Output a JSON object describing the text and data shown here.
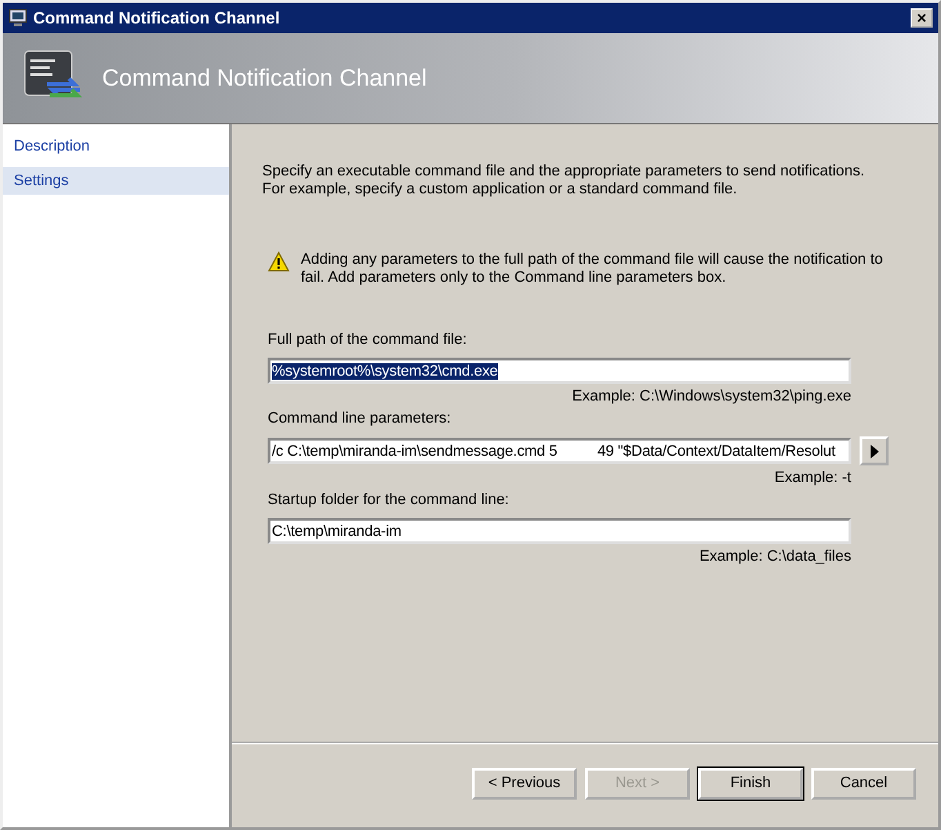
{
  "window": {
    "title": "Command Notification Channel",
    "close": "×"
  },
  "header": {
    "title": "Command Notification Channel"
  },
  "sidebar": {
    "items": [
      {
        "label": "Description",
        "selected": false
      },
      {
        "label": "Settings",
        "selected": true
      }
    ]
  },
  "intro": "Specify an executable command file and the appropriate parameters to send notifications. For example, specify a custom application or a standard command file.",
  "warning": "Adding any parameters to the full path of the command file will cause the notification to fail. Add parameters only to the Command line parameters box.",
  "fields": [
    {
      "label": "Full path of the command file:",
      "value": "%systemroot%\\system32\\cmd.exe",
      "highlighted": true,
      "example": "Example: C:\\Windows\\system32\\ping.exe",
      "kind": "plain"
    },
    {
      "label": "Command line parameters:",
      "value": "/c C:\\temp\\miranda-im\\sendmessage.cmd 5          49 \"$Data/Context/DataItem/Resolut",
      "highlighted": false,
      "example": "Example: -t",
      "kind": "with-arrow"
    },
    {
      "label": "Startup folder for the command line:",
      "value": "C:\\temp\\miranda-im",
      "highlighted": false,
      "example": "Example: C:\\data_files",
      "kind": "plain"
    }
  ],
  "buttons": [
    {
      "label": "< Previous",
      "disabled": false,
      "default": false
    },
    {
      "label": "Next >",
      "disabled": true,
      "default": false
    },
    {
      "label": "Finish",
      "disabled": false,
      "default": true
    },
    {
      "label": "Cancel",
      "disabled": false,
      "default": false
    }
  ]
}
